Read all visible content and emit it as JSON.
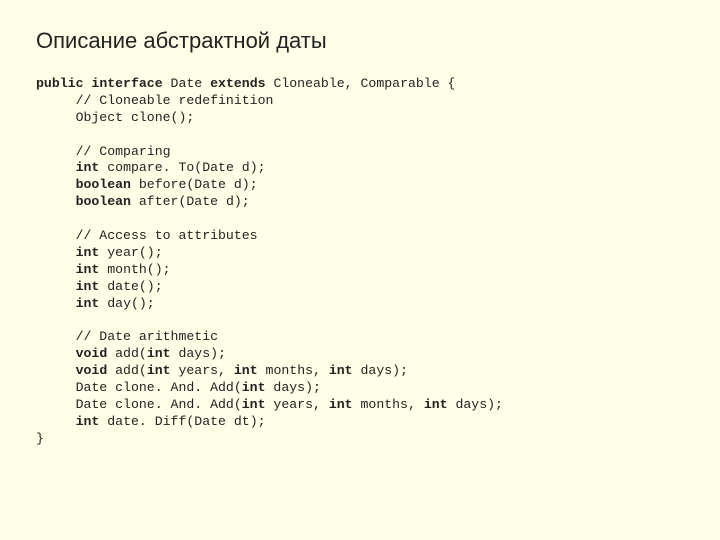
{
  "title": "Описание абстрактной даты",
  "code": {
    "l1a": "public",
    "l1b": "interface",
    "l1c": " Date ",
    "l1d": "extends",
    "l1e": " Cloneable, Comparable {",
    "l2": "     // Cloneable redefinition",
    "l3": "     Object clone();",
    "blank1": "",
    "l4": "     // Comparing",
    "l5a": "     ",
    "l5b": "int",
    "l5c": " compare. To(Date d);",
    "l6a": "     ",
    "l6b": "boolean",
    "l6c": " before(Date d);",
    "l7a": "     ",
    "l7b": "boolean",
    "l7c": " after(Date d);",
    "blank2": "",
    "l8": "     // Access to attributes",
    "l9a": "     ",
    "l9b": "int",
    "l9c": " year();",
    "l10a": "     ",
    "l10b": "int",
    "l10c": " month();",
    "l11a": "     ",
    "l11b": "int",
    "l11c": " date();",
    "l12a": "     ",
    "l12b": "int",
    "l12c": " day();",
    "blank3": "",
    "l13": "     // Date arithmetic",
    "l14a": "     ",
    "l14b": "void",
    "l14c": " add(",
    "l14d": "int",
    "l14e": " days);",
    "l15a": "     ",
    "l15b": "void",
    "l15c": " add(",
    "l15d": "int",
    "l15e": " years, ",
    "l15f": "int",
    "l15g": " months, ",
    "l15h": "int",
    "l15i": " days);",
    "l16a": "     Date clone. And. Add(",
    "l16b": "int",
    "l16c": " days);",
    "l17a": "     Date clone. And. Add(",
    "l17b": "int",
    "l17c": " years, ",
    "l17d": "int",
    "l17e": " months, ",
    "l17f": "int",
    "l17g": " days);",
    "l18a": "     ",
    "l18b": "int",
    "l18c": " date. Diff(Date dt);",
    "l19": "}"
  }
}
